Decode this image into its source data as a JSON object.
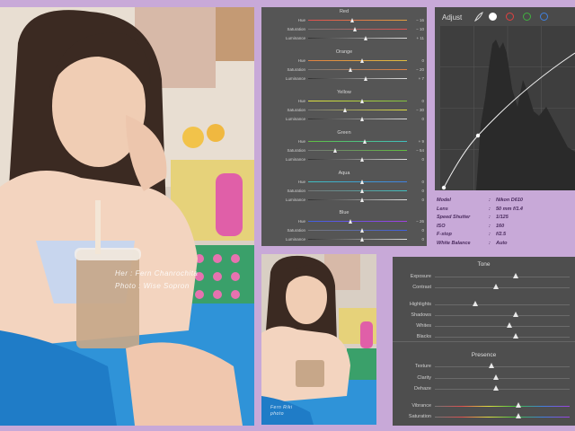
{
  "colors": {
    "background": "#c8a9d8",
    "panel": "#555555",
    "caption_text": "#4a2b5e"
  },
  "main_photo": {
    "credit_line1": "Her : Fern Chanrochita",
    "credit_line2": "Photo : Wise Sopron"
  },
  "thumb_photo": {
    "credit_line1": "Fern Riki",
    "credit_line2": "photo"
  },
  "hsl": {
    "groups": [
      {
        "title": "Red",
        "sliders": [
          {
            "label": "Hue",
            "value": "− 16",
            "level": 0.45
          },
          {
            "label": "Saturation",
            "value": "− 10",
            "level": 0.48
          },
          {
            "label": "Luminance",
            "value": "+ 11",
            "level": 0.59
          }
        ]
      },
      {
        "title": "Orange",
        "sliders": [
          {
            "label": "Hue",
            "value": "0",
            "level": 0.55
          },
          {
            "label": "Saturation",
            "value": "− 20",
            "level": 0.43
          },
          {
            "label": "Luminance",
            "value": "+ 7",
            "level": 0.59
          }
        ]
      },
      {
        "title": "Yellow",
        "sliders": [
          {
            "label": "Hue",
            "value": "0",
            "level": 0.55
          },
          {
            "label": "Saturation",
            "value": "− 30",
            "level": 0.38
          },
          {
            "label": "Luminance",
            "value": "0",
            "level": 0.55
          }
        ]
      },
      {
        "title": "Green",
        "sliders": [
          {
            "label": "Hue",
            "value": "+ 9",
            "level": 0.58
          },
          {
            "label": "Saturation",
            "value": "− 54",
            "level": 0.28
          },
          {
            "label": "Luminance",
            "value": "0",
            "level": 0.55
          }
        ]
      },
      {
        "title": "Aqua",
        "sliders": [
          {
            "label": "Hue",
            "value": "0",
            "level": 0.55
          },
          {
            "label": "Saturation",
            "value": "0",
            "level": 0.55
          },
          {
            "label": "Luminance",
            "value": "0",
            "level": 0.55
          }
        ]
      },
      {
        "title": "Blue",
        "sliders": [
          {
            "label": "Hue",
            "value": "− 26",
            "level": 0.43
          },
          {
            "label": "Saturation",
            "value": "0",
            "level": 0.55
          },
          {
            "label": "Luminance",
            "value": "0",
            "level": 0.55
          }
        ]
      }
    ]
  },
  "adjust": {
    "title": "Adjust",
    "channel_icons": [
      "brush-icon",
      "white-channel-icon",
      "red-channel-icon",
      "green-channel-icon",
      "blue-channel-icon"
    ],
    "channel_colors": [
      "#ffffff",
      "#e04040",
      "#40b040",
      "#4080e0"
    ]
  },
  "camera": [
    {
      "key": "Model",
      "value": "Nikon D610"
    },
    {
      "key": "Lens",
      "value": "50 mm f/1.4"
    },
    {
      "key": "Speed Shutter",
      "value": "1/125"
    },
    {
      "key": "ISO",
      "value": "160"
    },
    {
      "key": "F-stop",
      "value": "f/2.5"
    },
    {
      "key": "White Balance",
      "value": "Auto"
    }
  ],
  "camera_separator": ":",
  "tone": {
    "title": "Tone",
    "sliders": [
      {
        "label": "Exposure",
        "level": 0.6
      },
      {
        "label": "Contrast",
        "level": 0.45
      },
      {
        "label": "Highlights",
        "level": 0.3
      },
      {
        "label": "Shadows",
        "level": 0.6
      },
      {
        "label": "Whites",
        "level": 0.55
      },
      {
        "label": "Blacks",
        "level": 0.6
      }
    ]
  },
  "presence": {
    "title": "Presence",
    "sliders": [
      {
        "label": "Texture",
        "level": 0.42
      },
      {
        "label": "Clarity",
        "level": 0.45
      },
      {
        "label": "Dehaze",
        "level": 0.45
      },
      {
        "label": "Vibrance",
        "level": 0.62
      },
      {
        "label": "Saturation",
        "level": 0.62
      }
    ]
  }
}
